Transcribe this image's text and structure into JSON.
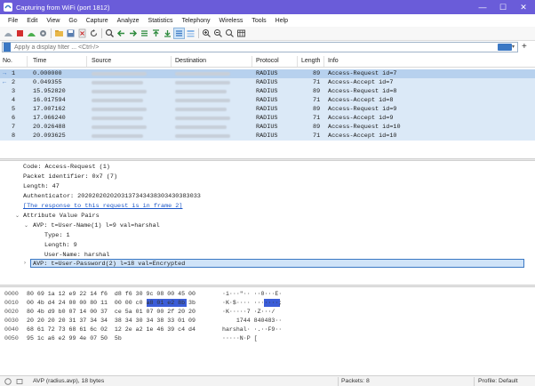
{
  "window": {
    "title": "Capturing from WiFi (port 1812)",
    "minimize_glyph": "—",
    "maximize_glyph": "☐",
    "close_glyph": "✕"
  },
  "menu": [
    "File",
    "Edit",
    "View",
    "Go",
    "Capture",
    "Analyze",
    "Statistics",
    "Telephony",
    "Wireless",
    "Tools",
    "Help"
  ],
  "toolbar": {
    "icons": [
      "shark-fin-icon",
      "stop-icon",
      "restart-icon",
      "options-gear-icon",
      "open-folder-icon",
      "save-icon",
      "close-file-icon",
      "reload-icon",
      "find-icon",
      "go-back-icon",
      "go-forward-icon",
      "go-to-packet-icon",
      "first-packet-icon",
      "last-packet-icon",
      "autoscroll-icon",
      "colorize-icon",
      "zoom-in-icon",
      "zoom-out-icon",
      "normal-size-icon",
      "resize-columns-icon"
    ]
  },
  "filter": {
    "placeholder": "Apply a display filter ... <Ctrl-/>"
  },
  "packet_list": {
    "columns": [
      "No.",
      "Time",
      "Source",
      "Destination",
      "Protocol",
      "Length",
      "Info"
    ],
    "rows": [
      {
        "no": "1",
        "time": "0.000000",
        "protocol": "RADIUS",
        "length": "89",
        "info": "Access-Request id=7",
        "marker": "→"
      },
      {
        "no": "2",
        "time": "0.049355",
        "protocol": "RADIUS",
        "length": "71",
        "info": "Access-Accept id=7",
        "marker": "←"
      },
      {
        "no": "3",
        "time": "15.952820",
        "protocol": "RADIUS",
        "length": "89",
        "info": "Access-Request id=8",
        "marker": ""
      },
      {
        "no": "4",
        "time": "16.017594",
        "protocol": "RADIUS",
        "length": "71",
        "info": "Access-Accept id=8",
        "marker": ""
      },
      {
        "no": "5",
        "time": "17.007162",
        "protocol": "RADIUS",
        "length": "89",
        "info": "Access-Request id=9",
        "marker": ""
      },
      {
        "no": "6",
        "time": "17.066240",
        "protocol": "RADIUS",
        "length": "71",
        "info": "Access-Accept id=9",
        "marker": ""
      },
      {
        "no": "7",
        "time": "20.026488",
        "protocol": "RADIUS",
        "length": "89",
        "info": "Access-Request id=10",
        "marker": ""
      },
      {
        "no": "8",
        "time": "20.093625",
        "protocol": "RADIUS",
        "length": "71",
        "info": "Access-Accept id=10",
        "marker": ""
      }
    ]
  },
  "details": {
    "code": "Code: Access-Request (1)",
    "identifier": "Packet identifier: 0x7 (7)",
    "length": "Length: 47",
    "authenticator": "Authenticator: 2020202020203137343438303430383033",
    "response_link": "[The response to this request is in frame 2]",
    "avp_header": "Attribute Value Pairs",
    "avp1": "AVP: t=User-Name(1) l=9 val=harshal",
    "avp1_type": "Type: 1",
    "avp1_length": "Length: 9",
    "avp1_username": "User-Name: harshal",
    "avp2": "AVP: t=User-Password(2) l=18 val=Encrypted"
  },
  "bytes": [
    {
      "offset": "0000",
      "hex": "80 69 1a 12 e9 22 14 f6  d8 f6 30 9c 08 00 45 00",
      "ascii": "·i···\"·· ··0···E·"
    },
    {
      "offset": "0010",
      "hex": "00 4b d4 24 00 00 80 11  00 00 c0 a8 01 e2 8b 3b",
      "ascii": "·K·$···· ·······;"
    },
    {
      "offset": "0020",
      "hex": "80 4b d9 b0 07 14 00 37  ce 5a 01 07 00 2f 20 20",
      "ascii": "·K·····7 ·Z···/  "
    },
    {
      "offset": "0030",
      "hex": "20 20 20 20 31 37 34 34  38 34 30 34 38 33 01 09",
      "ascii": "    1744 840483··"
    },
    {
      "offset": "0040",
      "hex": "68 61 72 73 68 61 6c 02  12 2e a2 1e 46 39 c4 d4",
      "ascii": "harshal· ·.··F9··"
    },
    {
      "offset": "0050",
      "hex": "95 1c a6 e2 99 4e 07 50  5b",
      "ascii": "·····N·P ["
    }
  ],
  "status": {
    "field": "AVP (radius.avp), 18 bytes",
    "packets": "Packets: 8",
    "profile": "Profile: Default"
  },
  "colors": {
    "title_bg": "#6a5cd9",
    "row_bg": "#dbe9f7",
    "selected_row_bg": "#b7d1ee",
    "link": "#1a55c7",
    "hex_highlight": "#3b5dd8"
  }
}
